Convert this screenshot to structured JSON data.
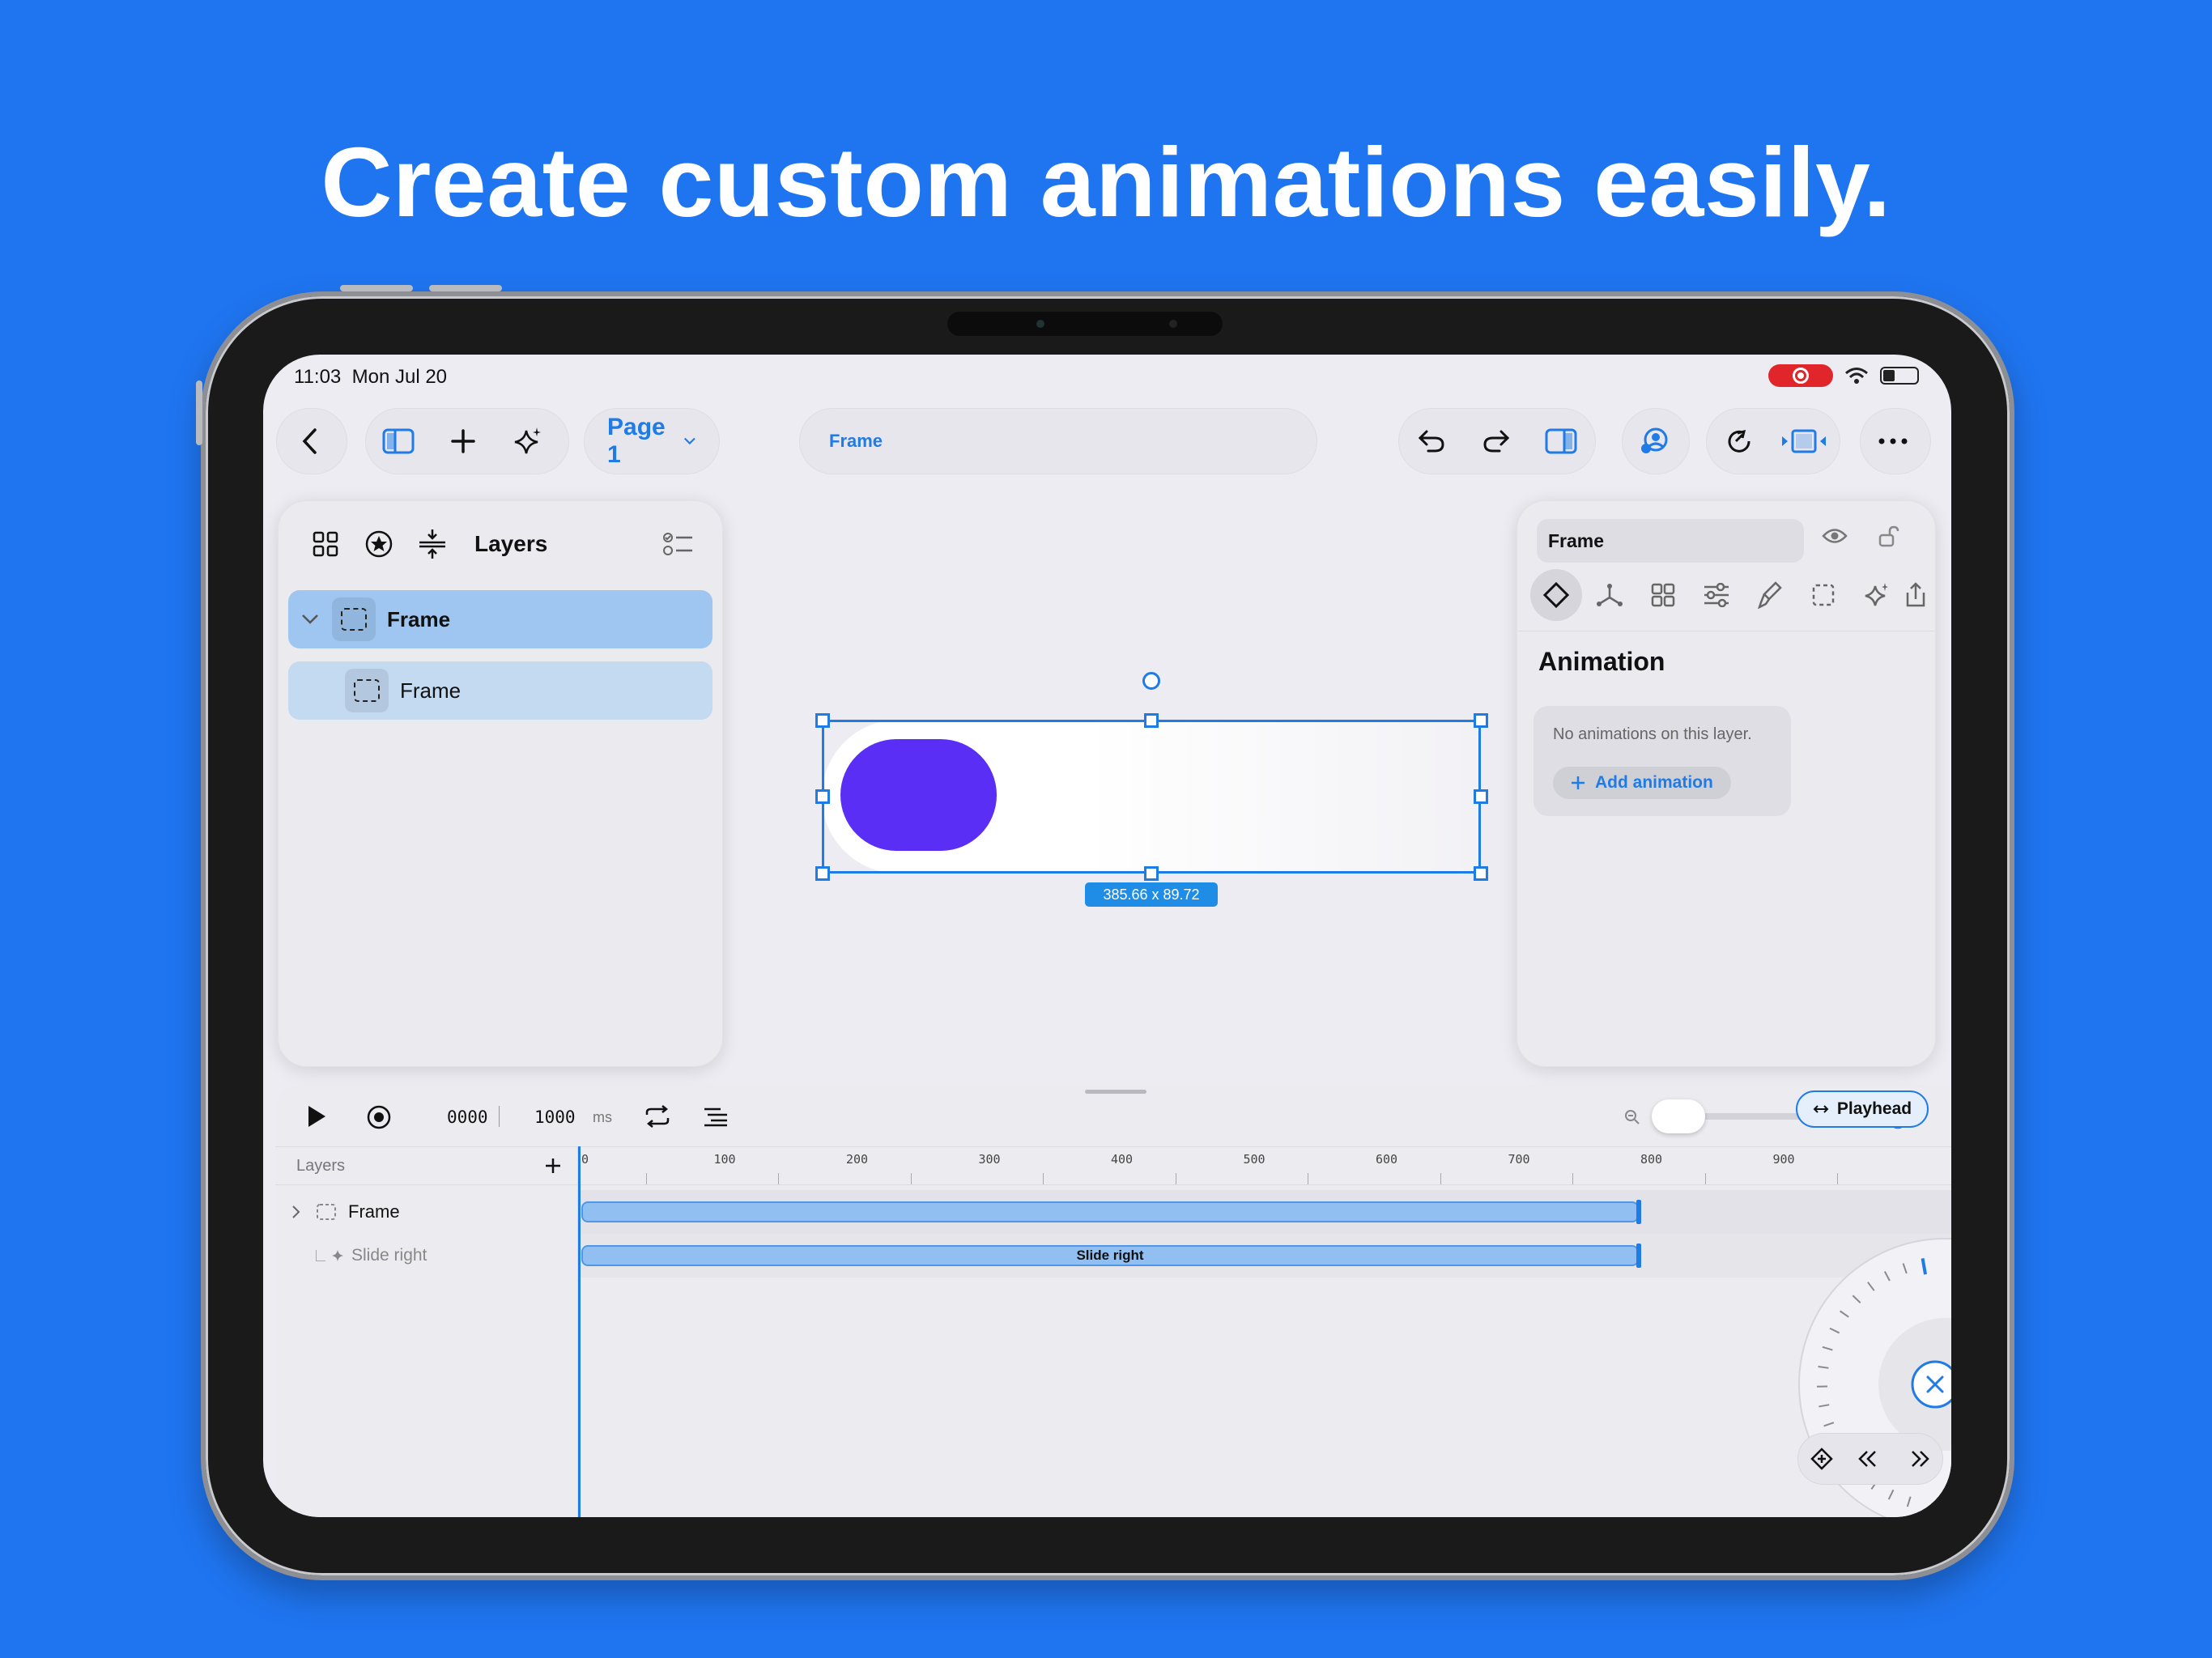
{
  "headline": "Create custom animations easily.",
  "status_bar": {
    "time": "11:03",
    "date": "Mon Jul 20"
  },
  "toolbar": {
    "page_label": "Page 1",
    "frame_label": "Frame"
  },
  "layers_panel": {
    "title": "Layers",
    "rows": [
      {
        "label": "Frame"
      },
      {
        "label": "Frame"
      }
    ]
  },
  "canvas": {
    "dimensions": "385.66 x 89.72",
    "accent_color": "#5b2ef5"
  },
  "inspector": {
    "name_value": "Frame",
    "section_title": "Animation",
    "empty_text": "No animations on this layer.",
    "add_button": "Add animation"
  },
  "timeline": {
    "current_time": "0000",
    "duration": "1000",
    "unit": "ms",
    "playhead_label": "Playhead",
    "layers_header": "Layers",
    "ruler": [
      "0",
      "100",
      "200",
      "300",
      "400",
      "500",
      "600",
      "700",
      "800",
      "900"
    ],
    "rows": [
      {
        "label": "Frame"
      },
      {
        "label": "Slide right"
      }
    ],
    "bar_label": "Slide right"
  },
  "colors": {
    "background": "#1f75f0",
    "accent": "#1f7be6"
  }
}
